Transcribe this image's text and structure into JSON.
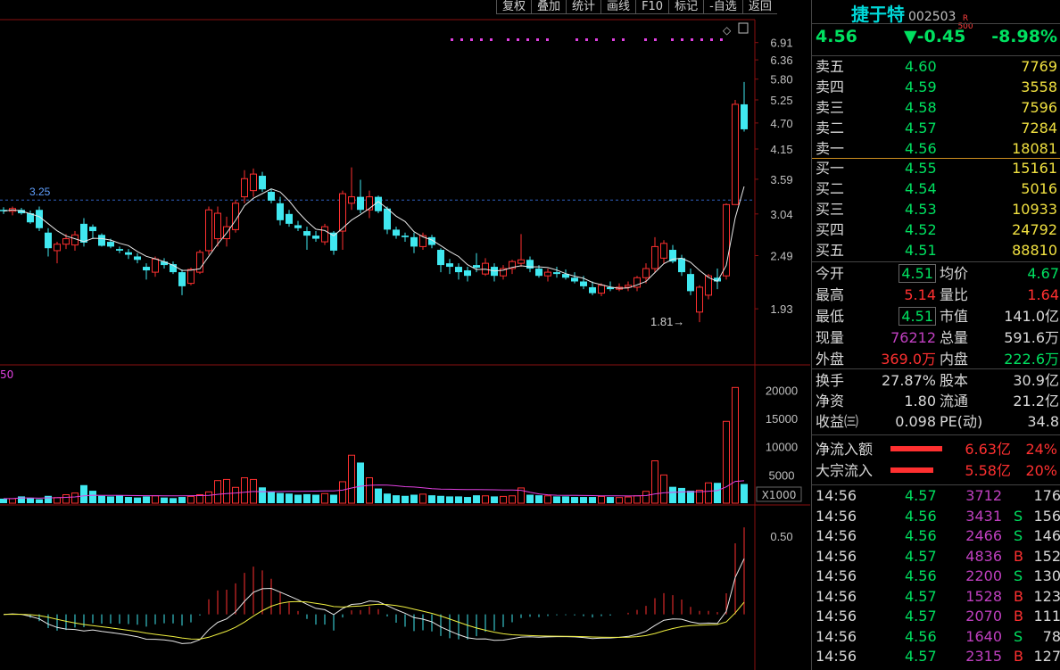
{
  "toolbar": [
    "复权",
    "叠加",
    "统计",
    "画线",
    "F10",
    "标记",
    "-自选",
    "返回"
  ],
  "stock": {
    "name": "捷于特",
    "code": "002503",
    "badge_top": "R",
    "badge_bottom": "500"
  },
  "quote": {
    "price": "4.56",
    "change": "▼-0.45",
    "pct": "-8.98%"
  },
  "asks": [
    {
      "label": "卖五",
      "price": "4.60",
      "vol": "7769"
    },
    {
      "label": "卖四",
      "price": "4.59",
      "vol": "3558"
    },
    {
      "label": "卖三",
      "price": "4.58",
      "vol": "7596"
    },
    {
      "label": "卖二",
      "price": "4.57",
      "vol": "7284"
    },
    {
      "label": "卖一",
      "price": "4.56",
      "vol": "18081"
    }
  ],
  "bids": [
    {
      "label": "买一",
      "price": "4.55",
      "vol": "15161"
    },
    {
      "label": "买二",
      "price": "4.54",
      "vol": "5016"
    },
    {
      "label": "买三",
      "price": "4.53",
      "vol": "10933"
    },
    {
      "label": "买四",
      "price": "4.52",
      "vol": "24792"
    },
    {
      "label": "买五",
      "price": "4.51",
      "vol": "88810"
    }
  ],
  "stats": [
    {
      "l1": "今开",
      "v1": "4.51",
      "c1": "#00e060",
      "box1": true,
      "l2": "均价",
      "v2": "4.67",
      "c2": "#00e060"
    },
    {
      "l1": "最高",
      "v1": "5.14",
      "c1": "#ff3030",
      "box1": false,
      "l2": "量比",
      "v2": "1.64",
      "c2": "#ff3030"
    },
    {
      "l1": "最低",
      "v1": "4.51",
      "c1": "#00e060",
      "box1": true,
      "l2": "市值",
      "v2": "141.0亿",
      "c2": "#d8d8d8"
    },
    {
      "l1": "现量",
      "v1": "76212",
      "c1": "#c040c0",
      "box1": false,
      "l2": "总量",
      "v2": "591.6万",
      "c2": "#d8d8d8"
    },
    {
      "l1": "外盘",
      "v1": "369.0万",
      "c1": "#ff3030",
      "box1": false,
      "l2": "内盘",
      "v2": "222.6万",
      "c2": "#00e060"
    }
  ],
  "info": [
    {
      "l1": "换手",
      "v1": "27.87%",
      "l2": "股本",
      "v2": "30.9亿"
    },
    {
      "l1": "净资",
      "v1": "1.80",
      "l2": "流通",
      "v2": "21.2亿"
    },
    {
      "l1": "收益㈢",
      "v1": "0.098",
      "l2": "PE(动)",
      "v2": "34.8"
    }
  ],
  "flows": [
    {
      "label": "净流入额",
      "value": "6.63亿",
      "pct": "24%",
      "bar_fraction": 0.24
    },
    {
      "label": "大宗流入",
      "value": "5.58亿",
      "pct": "20%",
      "bar_fraction": 0.2
    }
  ],
  "ticks": [
    {
      "time": "14:56",
      "price": "4.57",
      "vol": "3712",
      "side": "",
      "count": "176"
    },
    {
      "time": "14:56",
      "price": "4.56",
      "vol": "3431",
      "side": "S",
      "count": "156"
    },
    {
      "time": "14:56",
      "price": "4.56",
      "vol": "2466",
      "side": "S",
      "count": "146"
    },
    {
      "time": "14:56",
      "price": "4.57",
      "vol": "4836",
      "side": "B",
      "count": "152"
    },
    {
      "time": "14:56",
      "price": "4.56",
      "vol": "2200",
      "side": "S",
      "count": "130"
    },
    {
      "time": "14:56",
      "price": "4.57",
      "vol": "1528",
      "side": "B",
      "count": "123"
    },
    {
      "time": "14:56",
      "price": "4.57",
      "vol": "2070",
      "side": "B",
      "count": "111"
    },
    {
      "time": "14:56",
      "price": "4.56",
      "vol": "1640",
      "side": "S",
      "count": "78"
    },
    {
      "time": "14:56",
      "price": "4.57",
      "vol": "2315",
      "side": "B",
      "count": "127"
    }
  ],
  "colors": {
    "up": "#ff3030",
    "down": "#40e8f0",
    "ma": "#e8e8e8",
    "vol_ma": "#e040e0",
    "dif": "#f0f040",
    "grid": "#3050a0"
  },
  "chart_data": {
    "type": "candlestick",
    "price_axis_ticks": [
      "6.91",
      "6.36",
      "5.80",
      "5.25",
      "4.70",
      "4.15",
      "3.59",
      "3.04",
      "2.49",
      "1.93"
    ],
    "price_ylim": [
      1.6,
      7.05
    ],
    "reference_line": {
      "value": 3.25,
      "label": "3.25"
    },
    "low_marker": {
      "value": 1.81,
      "label": "1.81"
    },
    "candles": [
      [
        3.1,
        3.14,
        3.04,
        3.08
      ],
      [
        3.08,
        3.15,
        3.02,
        3.12
      ],
      [
        3.1,
        3.13,
        3.03,
        3.05
      ],
      [
        3.05,
        3.09,
        2.9,
        2.92
      ],
      [
        3.1,
        3.15,
        2.8,
        2.84
      ],
      [
        2.78,
        2.84,
        2.48,
        2.58
      ],
      [
        2.55,
        2.66,
        2.4,
        2.63
      ],
      [
        2.63,
        2.76,
        2.57,
        2.7
      ],
      [
        2.62,
        2.8,
        2.55,
        2.75
      ],
      [
        2.9,
        2.98,
        2.6,
        2.65
      ],
      [
        2.86,
        2.89,
        2.7,
        2.8
      ],
      [
        2.75,
        2.77,
        2.6,
        2.61
      ],
      [
        2.66,
        2.7,
        2.58,
        2.6
      ],
      [
        2.57,
        2.6,
        2.52,
        2.55
      ],
      [
        2.53,
        2.57,
        2.45,
        2.5
      ],
      [
        2.48,
        2.52,
        2.4,
        2.44
      ],
      [
        2.36,
        2.4,
        2.22,
        2.32
      ],
      [
        2.3,
        2.48,
        2.25,
        2.45
      ],
      [
        2.42,
        2.46,
        2.34,
        2.38
      ],
      [
        2.39,
        2.42,
        2.28,
        2.3
      ],
      [
        2.3,
        2.33,
        2.06,
        2.15
      ],
      [
        2.18,
        2.35,
        2.16,
        2.33
      ],
      [
        2.3,
        2.56,
        2.28,
        2.53
      ],
      [
        2.55,
        3.15,
        2.5,
        3.1
      ],
      [
        2.7,
        3.15,
        2.6,
        3.05
      ],
      [
        2.7,
        3.0,
        2.6,
        2.86
      ],
      [
        2.82,
        3.25,
        2.78,
        3.2
      ],
      [
        3.3,
        3.75,
        3.2,
        3.6
      ],
      [
        3.4,
        3.78,
        3.3,
        3.68
      ],
      [
        3.65,
        3.72,
        3.38,
        3.42
      ],
      [
        3.38,
        3.42,
        3.2,
        3.24
      ],
      [
        3.2,
        3.3,
        2.88,
        2.95
      ],
      [
        3.04,
        3.1,
        2.86,
        2.9
      ],
      [
        2.88,
        2.94,
        2.8,
        2.84
      ],
      [
        2.8,
        2.86,
        2.56,
        2.74
      ],
      [
        2.74,
        2.8,
        2.66,
        2.7
      ],
      [
        2.66,
        2.9,
        2.62,
        2.86
      ],
      [
        2.78,
        2.8,
        2.5,
        2.55
      ],
      [
        2.8,
        3.4,
        2.56,
        3.35
      ],
      [
        3.2,
        3.8,
        3.1,
        3.3
      ],
      [
        3.3,
        3.58,
        3.05,
        3.1
      ],
      [
        3.1,
        3.4,
        2.98,
        3.3
      ],
      [
        3.3,
        3.32,
        3.05,
        3.08
      ],
      [
        3.12,
        3.15,
        2.76,
        2.82
      ],
      [
        2.82,
        2.86,
        2.7,
        2.74
      ],
      [
        2.74,
        2.78,
        2.66,
        2.72
      ],
      [
        2.72,
        2.78,
        2.52,
        2.6
      ],
      [
        2.6,
        2.78,
        2.56,
        2.74
      ],
      [
        2.72,
        2.75,
        2.58,
        2.62
      ],
      [
        2.56,
        2.58,
        2.3,
        2.38
      ],
      [
        2.4,
        2.45,
        2.28,
        2.36
      ],
      [
        2.36,
        2.4,
        2.22,
        2.3
      ],
      [
        2.32,
        2.36,
        2.2,
        2.26
      ],
      [
        2.38,
        2.52,
        2.3,
        2.35
      ],
      [
        2.28,
        2.46,
        2.26,
        2.4
      ],
      [
        2.36,
        2.4,
        2.2,
        2.26
      ],
      [
        2.26,
        2.38,
        2.22,
        2.34
      ],
      [
        2.34,
        2.44,
        2.28,
        2.42
      ],
      [
        2.4,
        2.76,
        2.36,
        2.44
      ],
      [
        2.44,
        2.48,
        2.3,
        2.34
      ],
      [
        2.34,
        2.38,
        2.24,
        2.26
      ],
      [
        2.26,
        2.34,
        2.2,
        2.3
      ],
      [
        2.3,
        2.36,
        2.24,
        2.28
      ],
      [
        2.28,
        2.33,
        2.22,
        2.24
      ],
      [
        2.24,
        2.3,
        2.18,
        2.2
      ],
      [
        2.2,
        2.26,
        2.12,
        2.15
      ],
      [
        2.14,
        2.2,
        2.06,
        2.08
      ],
      [
        2.08,
        2.18,
        2.05,
        2.16
      ],
      [
        2.14,
        2.2,
        2.1,
        2.12
      ],
      [
        2.12,
        2.18,
        2.1,
        2.14
      ],
      [
        2.14,
        2.2,
        2.1,
        2.16
      ],
      [
        2.14,
        2.26,
        2.1,
        2.24
      ],
      [
        2.24,
        2.4,
        2.18,
        2.34
      ],
      [
        2.34,
        2.72,
        2.3,
        2.6
      ],
      [
        2.46,
        2.68,
        2.4,
        2.64
      ],
      [
        2.56,
        2.62,
        2.4,
        2.42
      ],
      [
        2.46,
        2.5,
        2.26,
        2.3
      ],
      [
        2.28,
        2.34,
        2.06,
        2.1
      ],
      [
        1.9,
        2.16,
        1.81,
        2.14
      ],
      [
        2.06,
        2.28,
        2.02,
        2.26
      ],
      [
        2.24,
        2.34,
        2.12,
        2.2
      ],
      [
        2.26,
        3.2,
        2.22,
        3.18
      ],
      [
        3.18,
        5.25,
        3.18,
        5.14
      ],
      [
        5.14,
        5.72,
        4.51,
        4.56
      ]
    ],
    "volume_axis_ticks": [
      "20000",
      "15000",
      "10000",
      "5000"
    ],
    "volume_unit": "X1000",
    "volume_ylim": [
      0,
      21500
    ],
    "volume": [
      800,
      800,
      1200,
      900,
      700,
      1300,
      1000,
      1500,
      1800,
      3200,
      2200,
      1300,
      1200,
      1400,
      1100,
      1000,
      1200,
      1300,
      1000,
      900,
      1100,
      1200,
      1500,
      2000,
      4000,
      4200,
      2800,
      4500,
      4200,
      2800,
      2000,
      1800,
      1700,
      1500,
      1600,
      1500,
      1700,
      1500,
      3800,
      8500,
      7200,
      4500,
      2600,
      1700,
      1400,
      1300,
      1500,
      1600,
      1400,
      1300,
      1200,
      1200,
      1100,
      1400,
      1300,
      1200,
      1200,
      1300,
      2700,
      1500,
      1400,
      1300,
      1200,
      1200,
      1100,
      1100,
      1100,
      1200,
      1100,
      1000,
      1100,
      1300,
      2100,
      7500,
      5000,
      2900,
      2700,
      2200,
      2300,
      3600,
      3600,
      14500,
      20500,
      3400
    ],
    "indicator_axis_ticks": [
      "0.50"
    ],
    "indicator_ylim": [
      -0.35,
      0.62
    ]
  }
}
